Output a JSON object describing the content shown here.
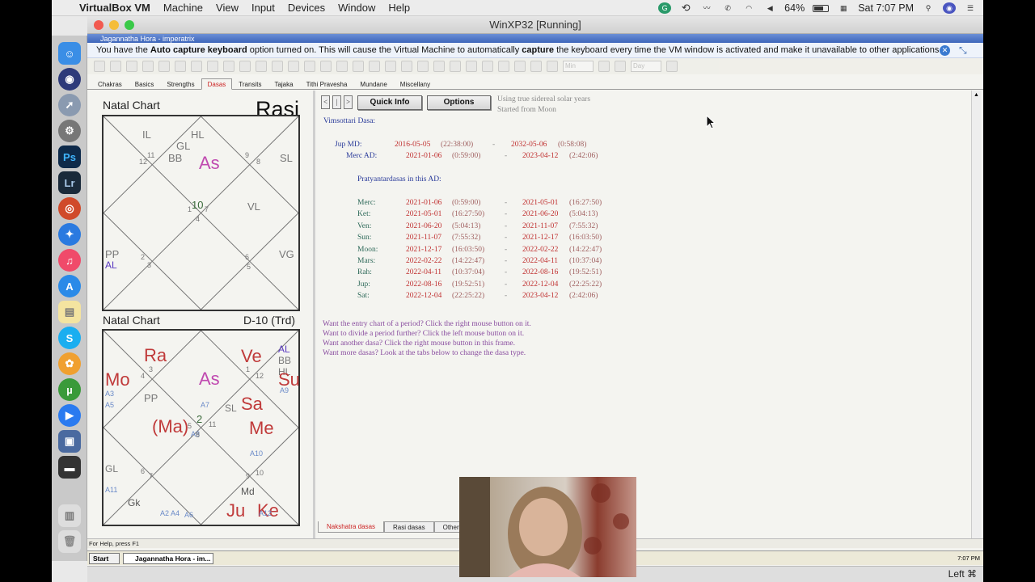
{
  "mac_menubar": {
    "app": "VirtualBox VM",
    "menus": [
      "Machine",
      "View",
      "Input",
      "Devices",
      "Window",
      "Help"
    ],
    "battery": "64%",
    "clock": "Sat 7:07 PM"
  },
  "vm_window": {
    "title": "WinXP32 [Running]",
    "status_hostkey": "Left ⌘"
  },
  "xp_app_title": "Jagannatha Hora - imperatrix",
  "notification": {
    "pre": "You have the ",
    "b1": "Auto capture keyboard",
    "mid1": " option turned on. This will cause the Virtual Machine to automatically ",
    "b2": "capture",
    "post": " the keyboard every time the VM window is activated and make it unavailable to other applications"
  },
  "toolbar": {
    "zoom_select": "Min",
    "unit_select": "Day"
  },
  "tabs": [
    "Chakras",
    "Basics",
    "Strengths",
    "Dasas",
    "Transits",
    "Tajaka",
    "Tithi Pravesha",
    "Mundane",
    "Miscellany"
  ],
  "active_tab": "Dasas",
  "rasi_chart": {
    "title": "Natal Chart",
    "label": "Rasi",
    "labels": [
      {
        "t": "IL",
        "c": "#777",
        "s": 13
      },
      {
        "t": "HL",
        "c": "#777",
        "s": 13
      },
      {
        "t": "GL",
        "c": "#777",
        "s": 13
      },
      {
        "t": "BB",
        "c": "#777",
        "s": 13
      },
      {
        "t": "As",
        "c": "#c04ab0",
        "s": 22
      },
      {
        "t": "SL",
        "c": "#777",
        "s": 13
      },
      {
        "t": "VL",
        "c": "#777",
        "s": 13
      },
      {
        "t": "PP",
        "c": "#777",
        "s": 13
      },
      {
        "t": "AL",
        "c": "#5a3ac0",
        "s": 12
      },
      {
        "t": "VG",
        "c": "#777",
        "s": 13
      }
    ],
    "nums": [
      "11",
      "12",
      "9",
      "8",
      "10",
      "1",
      "7",
      "4",
      "2",
      "3",
      "6",
      "5"
    ]
  },
  "d10_chart": {
    "title": "Natal Chart",
    "label": "D-10 (Trd)",
    "labels": [
      {
        "t": "Ra",
        "c": "#c03a3a",
        "s": 22
      },
      {
        "t": "Mo",
        "c": "#c03a3a",
        "s": 22
      },
      {
        "t": "As",
        "c": "#c04ab0",
        "s": 22
      },
      {
        "t": "Ve",
        "c": "#c03a3a",
        "s": 22
      },
      {
        "t": "AL",
        "c": "#5a3ac0",
        "s": 12
      },
      {
        "t": "BB",
        "c": "#777",
        "s": 12
      },
      {
        "t": "HL",
        "c": "#777",
        "s": 12
      },
      {
        "t": "Su",
        "c": "#c03a3a",
        "s": 22
      },
      {
        "t": "PP",
        "c": "#777",
        "s": 13
      },
      {
        "t": "Sa",
        "c": "#c03a3a",
        "s": 22
      },
      {
        "t": "SL",
        "c": "#777",
        "s": 12
      },
      {
        "t": "Me",
        "c": "#c03a3a",
        "s": 22
      },
      {
        "t": "(Ma)",
        "c": "#c03a3a",
        "s": 22
      },
      {
        "t": "GL",
        "c": "#777",
        "s": 12
      },
      {
        "t": "Md",
        "c": "#555",
        "s": 12
      },
      {
        "t": "Gk",
        "c": "#555",
        "s": 12
      },
      {
        "t": "Ju",
        "c": "#c03a3a",
        "s": 22
      },
      {
        "t": "Ke",
        "c": "#c03a3a",
        "s": 22
      },
      {
        "t": "A3",
        "c": "#6a8ac8",
        "s": 9
      },
      {
        "t": "A5",
        "c": "#6a8ac8",
        "s": 9
      },
      {
        "t": "A7",
        "c": "#6a8ac8",
        "s": 9
      },
      {
        "t": "A8",
        "c": "#6a8ac8",
        "s": 9
      },
      {
        "t": "A9",
        "c": "#6a8ac8",
        "s": 9
      },
      {
        "t": "A10",
        "c": "#6a8ac8",
        "s": 9
      },
      {
        "t": "A11",
        "c": "#6a8ac8",
        "s": 9
      },
      {
        "t": "A2 A4",
        "c": "#6a8ac8",
        "s": 9
      },
      {
        "t": "A6",
        "c": "#6a8ac8",
        "s": 9
      },
      {
        "t": "A12",
        "c": "#6a8ac8",
        "s": 9
      }
    ],
    "nums": [
      "4",
      "3",
      "1",
      "12",
      "2",
      "5",
      "11",
      "8",
      "6",
      "7",
      "9",
      "10"
    ]
  },
  "controls": {
    "prev": "<",
    "pause": "|",
    "next": ">",
    "quick_info": "Quick Info",
    "options": "Options",
    "note1": "Using true sidereal solar years",
    "note2": "Started from Moon"
  },
  "dasa": {
    "title": "Vimsottari Dasa:",
    "md": {
      "label": "Jup MD:",
      "start": "2016-05-05",
      "start_t": "(22:38:00)",
      "dash": "-",
      "end": "2032-05-06",
      "end_t": "(0:58:08)"
    },
    "ad": {
      "label": "Merc AD:",
      "start": "2021-01-06",
      "start_t": "(0:59:00)",
      "dash": "-",
      "end": "2023-04-12",
      "end_t": "(2:42:06)"
    },
    "pd_title": "Pratyantardasas in this AD:",
    "rows": [
      {
        "p": "Merc:",
        "s": "2021-01-06",
        "st": "(0:59:00)",
        "d": "-",
        "e": "2021-05-01",
        "et": "(16:27:50)"
      },
      {
        "p": "Ket:",
        "s": "2021-05-01",
        "st": "(16:27:50)",
        "d": "-",
        "e": "2021-06-20",
        "et": "(5:04:13)"
      },
      {
        "p": "Ven:",
        "s": "2021-06-20",
        "st": "(5:04:13)",
        "d": "-",
        "e": "2021-11-07",
        "et": "(7:55:32)"
      },
      {
        "p": "Sun:",
        "s": "2021-11-07",
        "st": "(7:55:32)",
        "d": "-",
        "e": "2021-12-17",
        "et": "(16:03:50)"
      },
      {
        "p": "Moon:",
        "s": "2021-12-17",
        "st": "(16:03:50)",
        "d": "-",
        "e": "2022-02-22",
        "et": "(14:22:47)"
      },
      {
        "p": "Mars:",
        "s": "2022-02-22",
        "st": "(14:22:47)",
        "d": "-",
        "e": "2022-04-11",
        "et": "(10:37:04)"
      },
      {
        "p": "Rah:",
        "s": "2022-04-11",
        "st": "(10:37:04)",
        "d": "-",
        "e": "2022-08-16",
        "et": "(19:52:51)"
      },
      {
        "p": "Jup:",
        "s": "2022-08-16",
        "st": "(19:52:51)",
        "d": "-",
        "e": "2022-12-04",
        "et": "(22:25:22)"
      },
      {
        "p": "Sat:",
        "s": "2022-12-04",
        "st": "(22:25:22)",
        "d": "-",
        "e": "2023-04-12",
        "et": "(2:42:06)"
      }
    ],
    "help": [
      "Want the entry chart of a period? Click the right mouse button on it.",
      "Want to divide a period further? Click the left mouse button on it.",
      "Want another dasa? Click the right mouse button in this frame.",
      "Want more dasas? Look at the tabs below to change the dasa type."
    ]
  },
  "bottom_tabs": [
    "Nakshatra dasas",
    "Rasi dasas",
    "Other"
  ],
  "statusbar": "For Help, press F1",
  "taskbar": {
    "start": "Start",
    "item": "Jagannatha Hora - im...",
    "clock": "7:07 PM"
  }
}
